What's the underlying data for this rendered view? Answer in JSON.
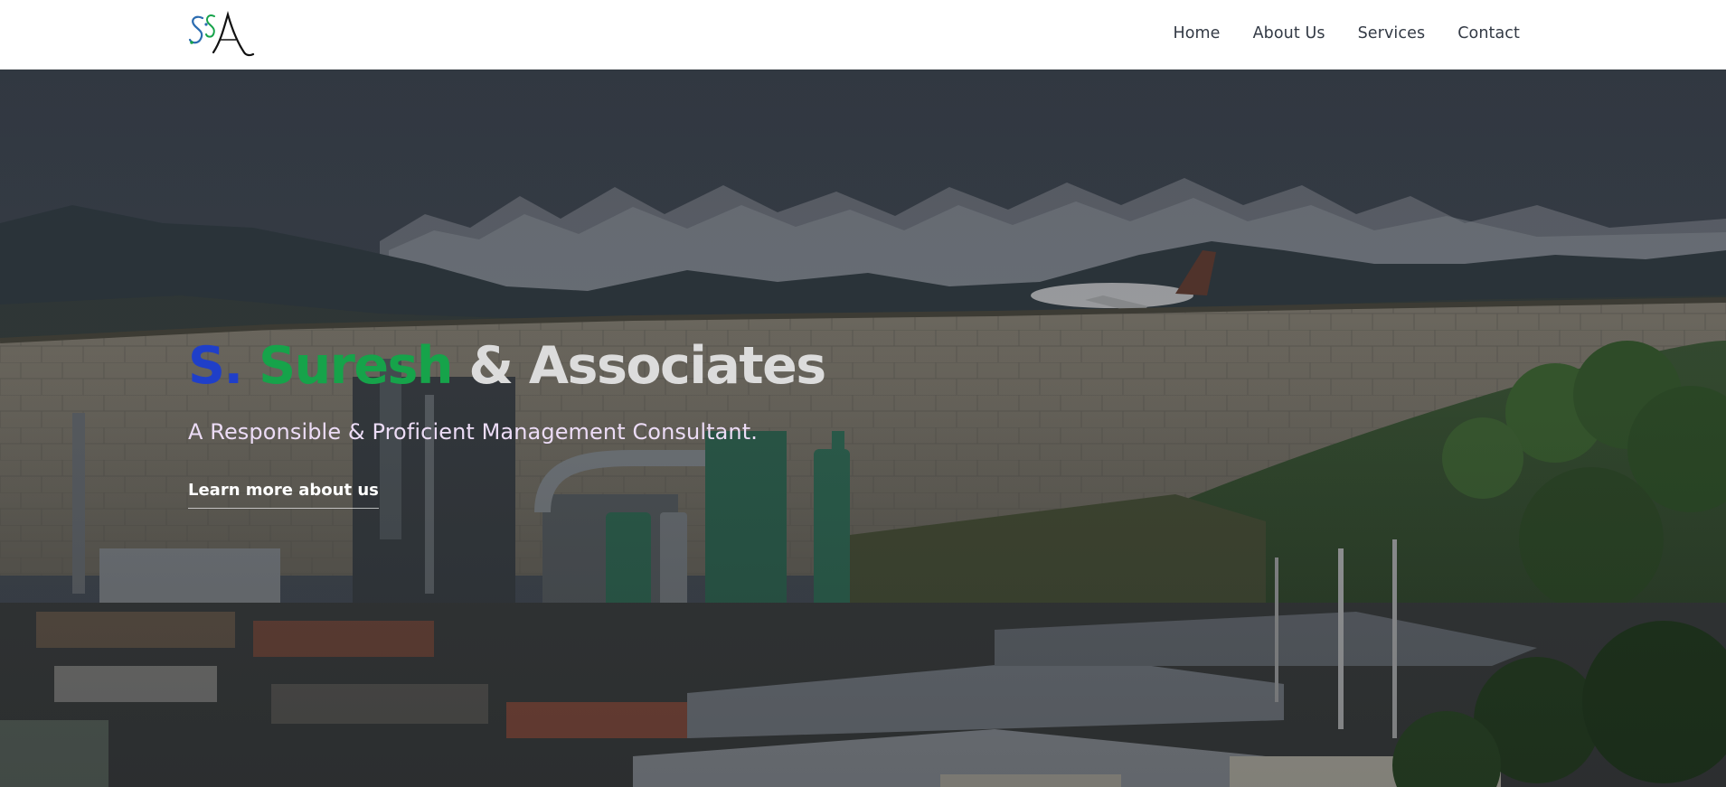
{
  "brand": {
    "logo_alt": "SSA",
    "logo_letters": [
      "S",
      "S",
      "A"
    ]
  },
  "nav": {
    "items": [
      {
        "label": "Home"
      },
      {
        "label": "About Us"
      },
      {
        "label": "Services"
      },
      {
        "label": "Contact"
      }
    ]
  },
  "hero": {
    "title_part1": "S.",
    "title_part2": "Suresh",
    "title_part3": "& Associates",
    "subtitle": "A Responsible & Proficient Management Consultant.",
    "cta_label": "Learn more about us"
  },
  "colors": {
    "title_blue": "#1f3fc9",
    "title_green": "#16a34a",
    "title_grey": "#dcdcdc",
    "subtitle": "#ecdcf6",
    "nav_text": "#333a45"
  }
}
